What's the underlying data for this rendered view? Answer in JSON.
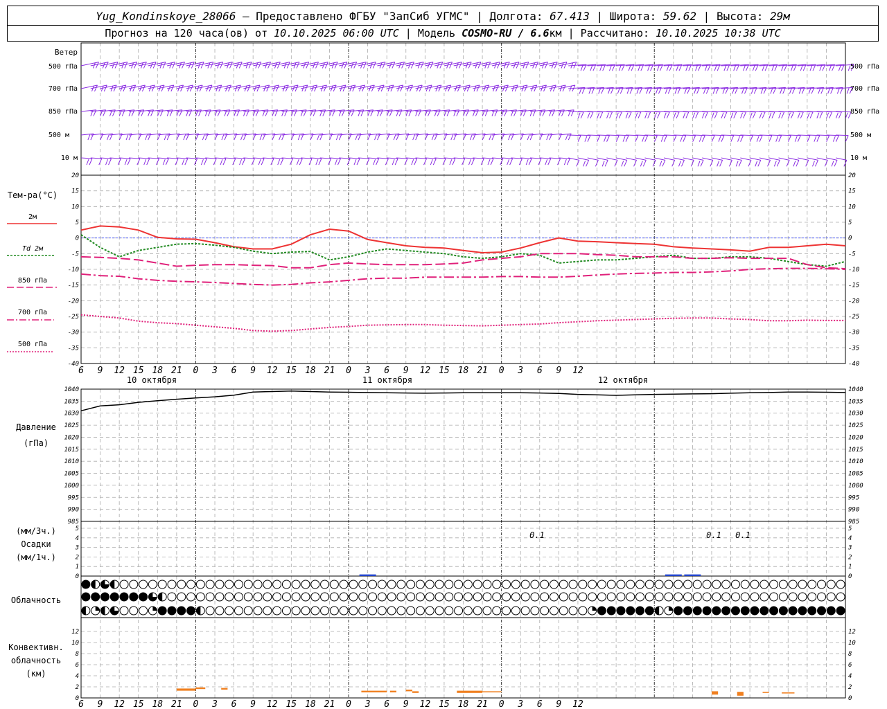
{
  "header": {
    "station": "Yug_Kondinskoye_28066",
    "provider": " – Предоставлено ФГБУ \"ЗапСиб УГМС\" | Долгота: ",
    "lon": "67.413",
    "lat_label": " | Широта: ",
    "lat": "59.62",
    "alt_label": " | Высота: ",
    "alt": "29м",
    "forecast_label": "Прогноз на 120 часа(ов) от ",
    "forecast_time": "10.10.2025 06:00 UTC",
    "model_label": "  | Модель ",
    "model": "COSMO-RU / 6.6",
    "model_unit": "км",
    "calc_label": " | Рассчитано: ",
    "calc_time": "10.10.2025 10:38 UTC"
  },
  "wind_panel": {
    "title": "Ветер",
    "levels": [
      "500 гПа",
      "700 гПа",
      "850 гПа",
      "500 м",
      "10  м"
    ],
    "color": "#8a2be2"
  },
  "temp_panel": {
    "title": "Тем-ра(°С)",
    "legend": [
      {
        "label": "2м",
        "color": "#ee3333",
        "style": "solid"
      },
      {
        "label": "Td  2м",
        "color": "#228b22",
        "style": "dotted"
      },
      {
        "label": "850 гПа",
        "color": "#e0207a",
        "style": "dashed"
      },
      {
        "label": "700 гПа",
        "color": "#e0207a",
        "style": "dashdot"
      },
      {
        "label": "500 гПа",
        "color": "#e0207a",
        "style": "dotted"
      }
    ]
  },
  "pressure_panel": {
    "title": "Давление",
    "unit": "(гПа)"
  },
  "precip_panel": {
    "unit1": "(мм/3ч.)",
    "title": "Осадки",
    "unit2": "(мм/1ч.)",
    "amounts": [
      "0.1",
      "0.1",
      "0.1"
    ]
  },
  "cloud_panel": {
    "title": "Облачность"
  },
  "conv_panel": {
    "title1": "Конвективн.",
    "title2": "облачность",
    "unit": "(км)"
  },
  "days": [
    "10 октября",
    "11 октября",
    "12 октября"
  ],
  "chart_data": [
    {
      "type": "line",
      "name": "temperature",
      "x_hours": [
        0,
        3,
        6,
        9,
        12,
        15,
        18,
        21,
        24,
        27,
        30,
        33,
        36,
        39,
        42,
        45,
        48,
        51,
        54,
        57,
        60,
        63,
        66,
        69,
        72,
        75,
        78,
        81,
        84,
        87,
        90,
        93,
        96,
        99,
        102,
        105,
        108,
        111,
        114,
        117,
        120
      ],
      "x_ticks": [
        "6",
        "9",
        "12",
        "15",
        "18",
        "21",
        "0",
        "3",
        "6",
        "9",
        "12",
        "15",
        "18",
        "21",
        "0",
        "3",
        "6",
        "9",
        "12",
        "15",
        "18",
        "21",
        "0",
        "3",
        "6",
        "9",
        "12"
      ],
      "ylim": [
        -40,
        20
      ],
      "y_ticks": [
        20,
        15,
        10,
        5,
        0,
        -5,
        -10,
        -15,
        -20,
        -25,
        -30,
        -35,
        -40
      ],
      "series": [
        {
          "name": "2м",
          "values": [
            2.5,
            3.8,
            3.5,
            2.5,
            0.2,
            -0.3,
            -0.4,
            -1.5,
            -2.8,
            -3.5,
            -3.5,
            -2.0,
            1.0,
            2.8,
            2.2,
            -0.5,
            -1.5,
            -2.5,
            -3.0,
            -3.2,
            -4.0,
            -4.7,
            -4.5,
            -3.2,
            -1.5,
            0.0,
            -1.0,
            -1.2,
            -1.5,
            -1.8,
            -2.0,
            -2.8,
            -3.2,
            -3.5,
            -3.8,
            -4.2,
            -3.0,
            -3.0,
            -2.5,
            -2.0,
            -2.5
          ]
        },
        {
          "name": "Td  2м",
          "values": [
            1.0,
            -3.0,
            -6.0,
            -4.0,
            -3.0,
            -2.0,
            -1.8,
            -2.3,
            -3.0,
            -4.2,
            -5.0,
            -4.5,
            -4.3,
            -7.0,
            -6.0,
            -4.5,
            -3.5,
            -4.0,
            -4.5,
            -5.0,
            -6.0,
            -6.5,
            -6.0,
            -5.0,
            -5.5,
            -8.0,
            -7.5,
            -7.0,
            -7.0,
            -6.5,
            -6.0,
            -5.5,
            -6.5,
            -6.5,
            -6.0,
            -6.0,
            -6.5,
            -7.5,
            -8.5,
            -9.0,
            -7.5
          ]
        },
        {
          "name": "850 гПа",
          "values": [
            -6.0,
            -6.2,
            -6.5,
            -7.0,
            -8.0,
            -9.0,
            -8.7,
            -8.5,
            -8.5,
            -8.7,
            -8.8,
            -9.5,
            -9.5,
            -8.5,
            -8.0,
            -8.3,
            -8.5,
            -8.5,
            -8.5,
            -8.3,
            -8.0,
            -7.0,
            -6.5,
            -6.0,
            -5.0,
            -5.0,
            -5.0,
            -5.3,
            -5.5,
            -6.0,
            -6.0,
            -6.0,
            -6.5,
            -6.5,
            -6.3,
            -6.5,
            -6.5,
            -6.5,
            -8.5,
            -9.5,
            -9.8
          ]
        },
        {
          "name": "700 гПа",
          "values": [
            -11.5,
            -12.0,
            -12.2,
            -13.0,
            -13.5,
            -13.8,
            -14.0,
            -14.2,
            -14.5,
            -14.8,
            -15.0,
            -14.8,
            -14.3,
            -14.0,
            -13.5,
            -13.0,
            -12.8,
            -12.8,
            -12.5,
            -12.5,
            -12.5,
            -12.5,
            -12.3,
            -12.3,
            -12.5,
            -12.5,
            -12.2,
            -11.8,
            -11.5,
            -11.3,
            -11.2,
            -11.0,
            -11.0,
            -10.8,
            -10.5,
            -10.0,
            -9.8,
            -9.7,
            -9.7,
            -9.8,
            -10.0
          ]
        },
        {
          "name": "500 гПа",
          "values": [
            -24.5,
            -25.0,
            -25.5,
            -26.5,
            -27.0,
            -27.3,
            -27.8,
            -28.3,
            -28.8,
            -29.5,
            -29.7,
            -29.5,
            -29.0,
            -28.5,
            -28.2,
            -27.8,
            -27.7,
            -27.6,
            -27.6,
            -27.8,
            -27.9,
            -28.0,
            -27.8,
            -27.6,
            -27.4,
            -27.0,
            -26.7,
            -26.4,
            -26.2,
            -26.0,
            -25.8,
            -25.6,
            -25.5,
            -25.5,
            -25.8,
            -26.0,
            -26.4,
            -26.4,
            -26.2,
            -26.3,
            -26.3
          ]
        }
      ]
    },
    {
      "type": "line",
      "name": "pressure",
      "x_hours": [
        0,
        3,
        6,
        9,
        12,
        15,
        18,
        21,
        24,
        27,
        30,
        33,
        36,
        39,
        42,
        45,
        48,
        51,
        54,
        57,
        60,
        63,
        66,
        69,
        72,
        75,
        78,
        81,
        84,
        87,
        90,
        93,
        96,
        99,
        102,
        105,
        108,
        111,
        114,
        117,
        120
      ],
      "ylim": [
        985,
        1040
      ],
      "y_ticks": [
        1040,
        1035,
        1030,
        1025,
        1020,
        1015,
        1010,
        1005,
        1000,
        995,
        990,
        985
      ],
      "series": [
        {
          "name": "",
          "values": [
            1031.0,
            1033.0,
            1033.5,
            1034.5,
            1035.2,
            1035.8,
            1036.3,
            1036.8,
            1037.5,
            1038.8,
            1039.0,
            1039.2,
            1039.0,
            1038.8,
            1038.7,
            1038.6,
            1038.5,
            1038.4,
            1038.3,
            1038.4,
            1038.5,
            1038.5,
            1038.5,
            1038.5,
            1038.4,
            1038.2,
            1037.8,
            1037.6,
            1037.4,
            1037.6,
            1037.8,
            1037.9,
            1038.0,
            1038.1,
            1038.3,
            1038.5,
            1038.6,
            1038.8,
            1038.8,
            1038.7,
            1038.6
          ]
        }
      ]
    },
    {
      "type": "bar",
      "name": "precipitation",
      "ylim": [
        0,
        5
      ],
      "y_ticks": [
        5,
        4,
        3,
        2,
        1,
        0
      ],
      "bars": [
        {
          "hour": 45,
          "value": 0.1
        },
        {
          "hour": 93,
          "value": 0.1
        },
        {
          "hour": 96,
          "value": 0.1
        }
      ]
    },
    {
      "type": "bar",
      "name": "convective_cloud",
      "ylim": [
        0,
        14
      ],
      "y_ticks": [
        12,
        10,
        8,
        6,
        4,
        2,
        0
      ],
      "segments": [
        {
          "from": 15,
          "to": 18,
          "base": 1.3,
          "top": 1.7
        },
        {
          "from": 18,
          "to": 19.5,
          "base": 1.6,
          "top": 1.9
        },
        {
          "from": 22,
          "to": 23,
          "base": 1.5,
          "top": 1.8
        },
        {
          "from": 44,
          "to": 48,
          "base": 1.0,
          "top": 1.3
        },
        {
          "from": 48.5,
          "to": 49.5,
          "base": 1.0,
          "top": 1.3
        },
        {
          "from": 51,
          "to": 52,
          "base": 1.2,
          "top": 1.5
        },
        {
          "from": 52,
          "to": 53,
          "base": 0.9,
          "top": 1.2
        },
        {
          "from": 59,
          "to": 63,
          "base": 0.9,
          "top": 1.3
        },
        {
          "from": 63,
          "to": 66,
          "base": 1.0,
          "top": 1.2
        },
        {
          "from": 99,
          "to": 100,
          "base": 0.6,
          "top": 1.2
        },
        {
          "from": 103,
          "to": 104,
          "base": 0.4,
          "top": 1.1
        },
        {
          "from": 107,
          "to": 108,
          "base": 0.9,
          "top": 1.1
        },
        {
          "from": 110,
          "to": 112,
          "base": 0.8,
          "top": 1.0
        }
      ],
      "color": "#f08020"
    },
    {
      "type": "table",
      "name": "cloud_cover",
      "symbols": "f=full cover, e=empty, h=half, q=quarter, t=three-quarter",
      "rows": [
        "fhtheeeeeeeeeeeeeeeeeeeeeeeeeeeeeeeeeeeeeeeeeeeeeeeeeeeeeeeeeeeeeeeeeeeeeeeeeeeeeeeeeeeeeeeeeeeeeeeeeeeeeeeeeeeeeeeeeeeeeeeeeeeeeeeeeeeeeeeeeeeeeeeeeeeeeeeeeeeeee",
        "ffffffftheeeeeeeeeeeeeeeeeeeeeeeeeeeeeeeeeeeeeeeeeeeeeeeeeeeeeeeeeeeeeeeeeeeeeeeeeeeeeeeeeeeeeeeeeeeeeeeeeeeeeeeeeeeeeeeeeeeeeeeeeeeeeeeeeeeeeeeeeeeeeeeeeeeeeeeeeeeee",
        "hqhteeeqffffheeeeeeeeeeeeeeeeeeeeeeeeeeeeeeeeeeeeeeeeqffffffhqfffffffffffffffffffffeffffffhh"
      ]
    }
  ]
}
